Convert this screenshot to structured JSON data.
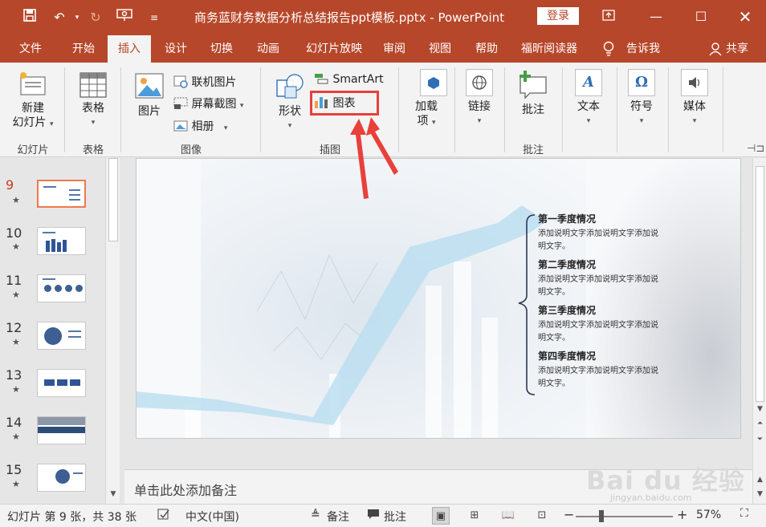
{
  "window": {
    "title": "商务蓝财务数据分析总结报告ppt模板.pptx  -  PowerPoint",
    "login_label": "登录"
  },
  "menu": {
    "tabs": [
      "文件",
      "开始",
      "插入",
      "设计",
      "切换",
      "动画",
      "幻灯片放映",
      "审阅",
      "视图",
      "帮助",
      "福昕阅读器"
    ],
    "active_tab": "插入",
    "tell_me": "告诉我",
    "share": "共享"
  },
  "ribbon": {
    "new_slide": {
      "line1": "新建",
      "line2": "幻灯片"
    },
    "table": "表格",
    "picture": "图片",
    "online_picture": "联机图片",
    "screenshot": "屏幕截图",
    "album": "相册",
    "shapes": "形状",
    "smartart": "SmartArt",
    "chart": "图表",
    "addins": {
      "line1": "加载",
      "line2": "项"
    },
    "link": "链接",
    "comment": "批注",
    "text": "文本",
    "symbol": "符号",
    "media": "媒体",
    "groups": {
      "slides": "幻灯片",
      "tables": "表格",
      "images": "图像",
      "illustrations": "插图",
      "comments": "批注"
    }
  },
  "thumbnails": [
    {
      "num": "9",
      "active": true
    },
    {
      "num": "10",
      "active": false
    },
    {
      "num": "11",
      "active": false
    },
    {
      "num": "12",
      "active": false
    },
    {
      "num": "13",
      "active": false
    },
    {
      "num": "14",
      "active": false
    },
    {
      "num": "15",
      "active": false
    }
  ],
  "slide": {
    "quarters": [
      {
        "title": "第一季度情况",
        "desc": "添加说明文字添加说明文字添加说明文字。"
      },
      {
        "title": "第二季度情况",
        "desc": "添加说明文字添加说明文字添加说明文字。"
      },
      {
        "title": "第三季度情况",
        "desc": "添加说明文字添加说明文字添加说明文字。"
      },
      {
        "title": "第四季度情况",
        "desc": "添加说明文字添加说明文字添加说明文字。"
      }
    ]
  },
  "notes": {
    "placeholder": "单击此处添加备注"
  },
  "watermark": {
    "logo": "Bai du 经验",
    "url": "jingyan.baidu.com"
  },
  "statusbar": {
    "slide_info": "幻灯片 第 9 张，共 38 张",
    "language": "中文(中国)",
    "notes": "备注",
    "comments": "批注",
    "zoom": "57%",
    "zoom_level": 0.57
  },
  "colors": {
    "accent": "#b7472a",
    "highlight": "#e8403b",
    "active_thumb_border": "#f07850"
  }
}
